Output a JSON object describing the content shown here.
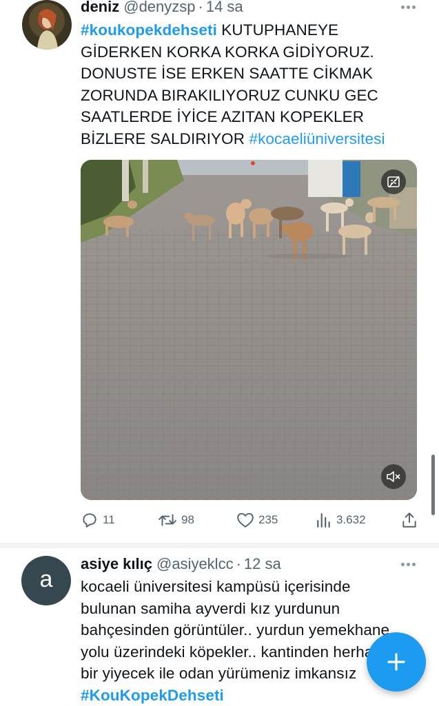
{
  "tweets": [
    {
      "name": "deniz",
      "handle": "@denyzsp",
      "separator": "·",
      "time": "14 sa",
      "hashtag_lead": "#koukopekdehseti",
      "text": " KUTUPHANEYE GİDERKEN KORKA KORKA GİDİYORUZ. DONUSTE İSE ERKEN SAATTE CİKMAK ZORUNDA BIRAKILIYORUZ CUNKU GEC SAATLERDE İYİCE AZITAN KOPEKLER BİZLERE SALDIRIYOR ",
      "hashtag_tail": "#kocaeliüniversitesi",
      "stats": {
        "replies": "11",
        "retweets": "98",
        "likes": "235",
        "views": "3.632"
      }
    },
    {
      "name": "asiye kılıç",
      "handle": "@asiyeklcc",
      "separator": "·",
      "time": "12 sa",
      "avatar_letter": "a",
      "text": "kocaeli üniversitesi kampüsü içerisinde bulunan samiha ayverdi kız yurdunun bahçesinden görüntüler.. yurdun yemekhane yolu üzerindeki köpekler.. kantinden herhangi bir yiyecek ile odan yürümeniz imkansız ",
      "hashtag_tail": "#KouKopekDehseti"
    }
  ],
  "colors": {
    "accent": "#1d9bf0",
    "secondary_text": "#536471",
    "avatar_gray": "#37474f"
  },
  "icons": {
    "reply": "reply-icon",
    "retweet": "retweet-icon",
    "like": "heart-icon",
    "views": "views-icon",
    "share": "share-icon",
    "cc": "closed-captions-icon",
    "mute": "muted-speaker-icon",
    "compose": "plus-icon"
  }
}
